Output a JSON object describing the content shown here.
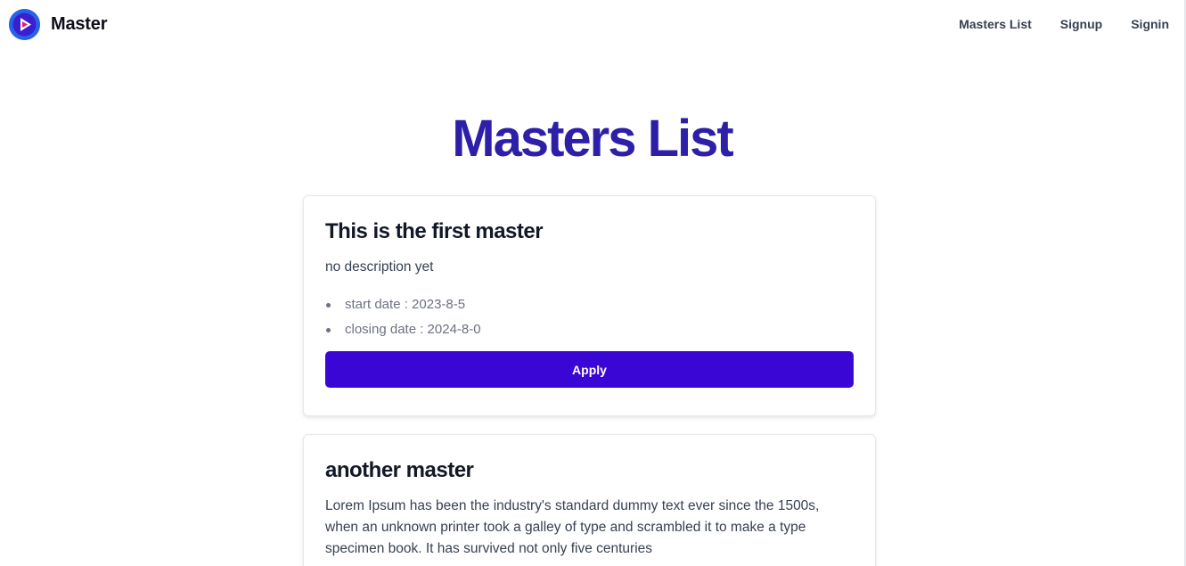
{
  "brand": {
    "name": "Master",
    "logo_icon": "play-icon",
    "accent": "#3b82f6"
  },
  "nav": {
    "links": [
      "Masters List",
      "Signup",
      "Signin"
    ]
  },
  "page": {
    "title": "Masters List",
    "title_color": "#2d1fa8"
  },
  "masters": [
    {
      "title": "This is the first master",
      "description": "no description yet",
      "start_date": "start date : 2023-8-5",
      "closing_date": "closing date : 2024-8-0",
      "apply_label": "Apply"
    },
    {
      "title": "another master",
      "description": "Lorem Ipsum has been the industry's standard dummy text ever since the 1500s, when an unknown printer took a galley of type and scrambled it to make a type specimen book. It has survived not only five centuries"
    }
  ],
  "colors": {
    "button": "#3a06d6"
  }
}
